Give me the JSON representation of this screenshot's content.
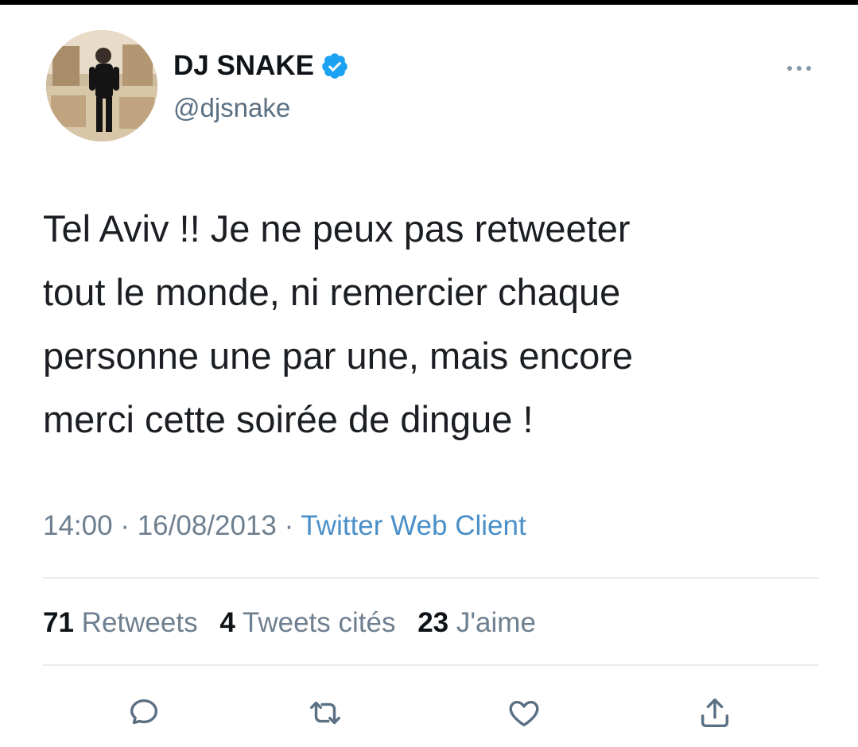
{
  "author": {
    "name": "DJ SNAKE",
    "handle": "@djsnake",
    "verified": true
  },
  "tweet": {
    "text": "Tel Aviv !! Je ne peux pas retweeter\ntout le monde, ni remercier chaque\npersonne une par une, mais encore\nmerci cette soirée de dingue !",
    "time": "14:00",
    "separator": " · ",
    "date": "16/08/2013",
    "source": "Twitter Web Client"
  },
  "stats": {
    "retweets_count": "71",
    "retweets_label": "Retweets",
    "quotes_count": "4",
    "quotes_label": "Tweets cités",
    "likes_count": "23",
    "likes_label": "J'aime"
  },
  "icons": {
    "more": "more-horizontal-icon",
    "reply": "reply-icon",
    "retweet": "retweet-icon",
    "like": "heart-icon",
    "share": "share-icon",
    "verified": "verified-badge-icon"
  },
  "colors": {
    "verified_blue": "#1da1f2",
    "link_blue": "#4a8fc8",
    "secondary_text": "#6e7f8f",
    "icon_gray": "#5b7083"
  }
}
